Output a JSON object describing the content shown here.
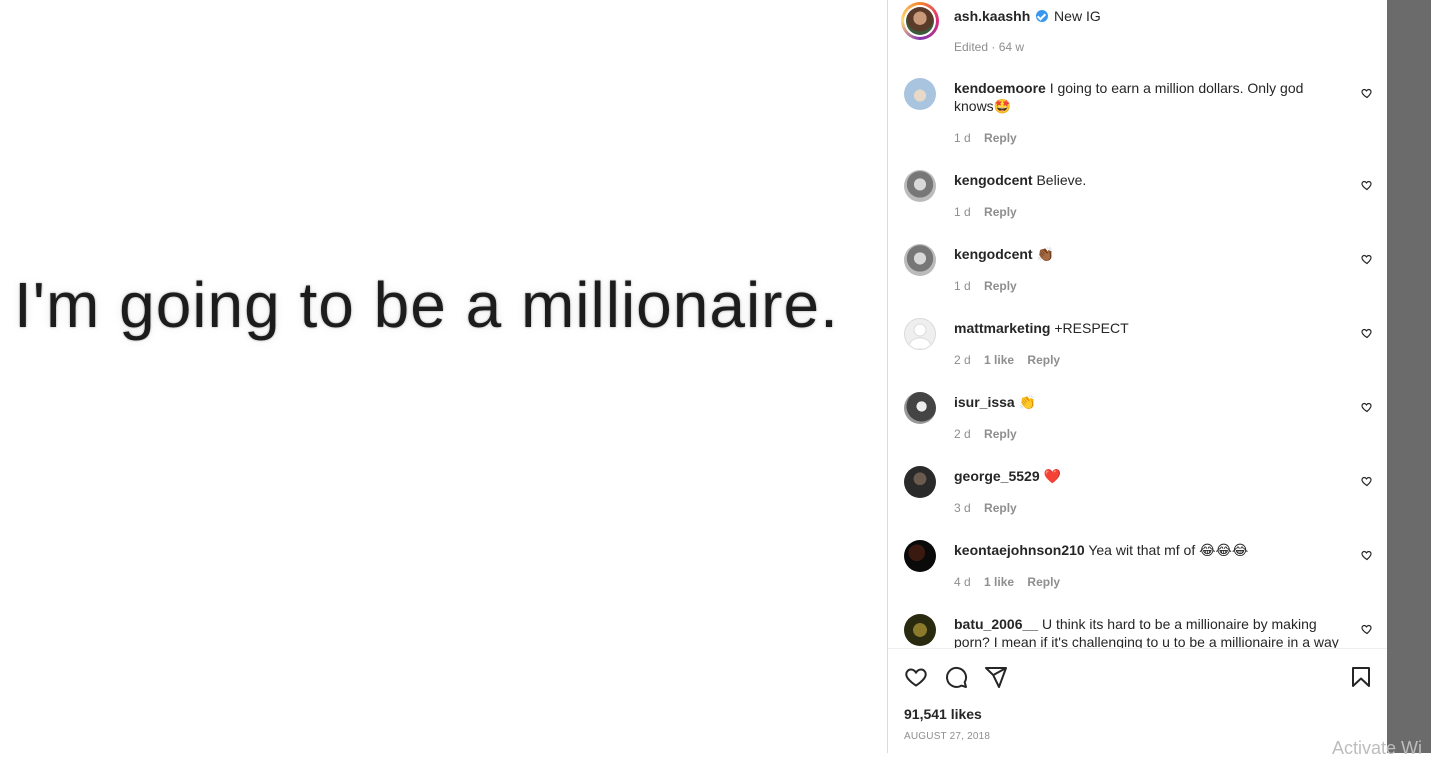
{
  "post": {
    "image_text": "I'm going to be a millionaire."
  },
  "caption": {
    "username": "ash.kaashh",
    "text": "New IG",
    "meta": "Edited · 64 w"
  },
  "comments": [
    {
      "username": "kendoemoore",
      "text": "I going to earn a million dollars. Only god knows🤩",
      "time": "1 d",
      "likes": "",
      "reply": "Reply"
    },
    {
      "username": "kengodcent",
      "text": "Believe.",
      "time": "1 d",
      "likes": "",
      "reply": "Reply"
    },
    {
      "username": "kengodcent",
      "text": "👏🏾",
      "time": "1 d",
      "likes": "",
      "reply": "Reply"
    },
    {
      "username": "mattmarketing",
      "text": "+RESPECT",
      "time": "2 d",
      "likes": "1 like",
      "reply": "Reply"
    },
    {
      "username": "isur_issa",
      "text": "👏",
      "time": "2 d",
      "likes": "",
      "reply": "Reply"
    },
    {
      "username": "george_5529",
      "text": "❤️",
      "time": "3 d",
      "likes": "",
      "reply": "Reply"
    },
    {
      "username": "keontaejohnson210",
      "text": "Yea wit that mf of 😂😂😂",
      "time": "4 d",
      "likes": "1 like",
      "reply": "Reply"
    },
    {
      "username": "batu_2006__",
      "text": "U think its hard to be a millionaire by making porn? I mean if it's challenging to u to be a millionaire in a way",
      "time": "",
      "likes": "",
      "reply": ""
    }
  ],
  "actions": {
    "likes": "91,541 likes",
    "date": "AUGUST 27, 2018"
  },
  "overlay": {
    "watermark": "Activate Wi"
  },
  "colors": {
    "username": "#262626",
    "meta": "#8e8e8e",
    "verified": "#3897f0",
    "heart_red": "#ed4956"
  }
}
